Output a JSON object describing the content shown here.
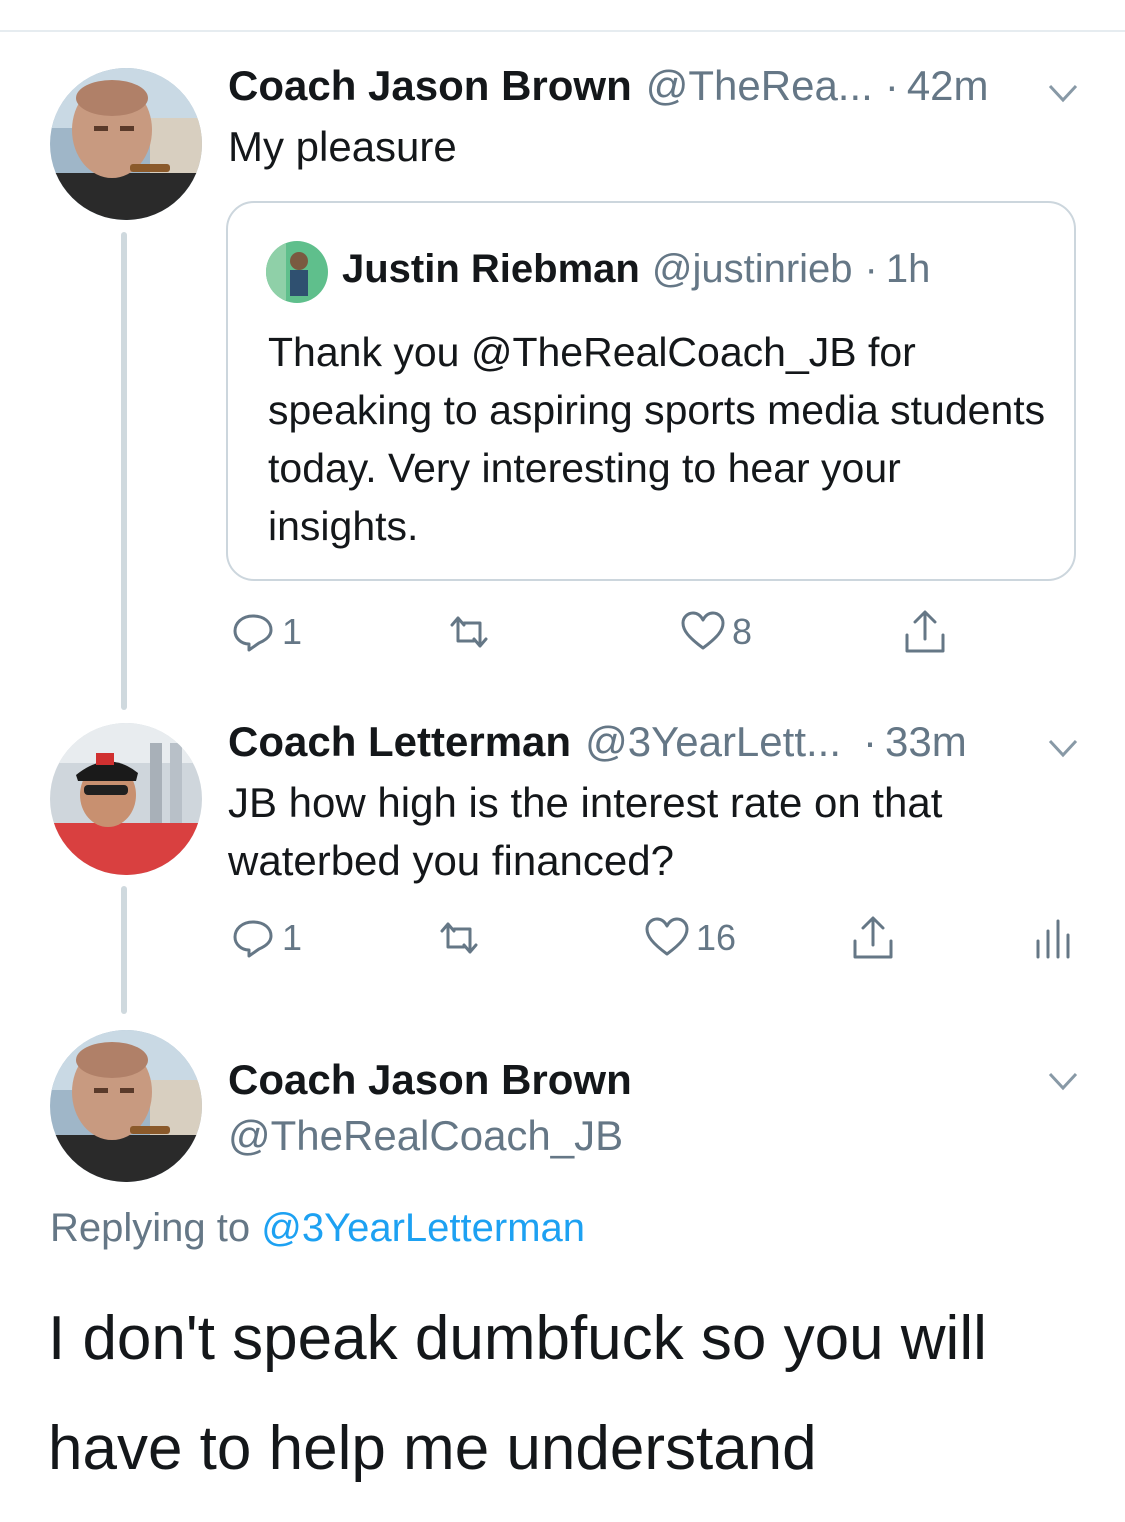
{
  "tweets": [
    {
      "name": "Coach Jason Brown",
      "handle": "@TheRea...",
      "dot": "·",
      "time": "42m",
      "text": "My pleasure",
      "quote": {
        "name": "Justin Riebman",
        "handle": "@justinrieb",
        "dot": "·",
        "time": "1h",
        "text": "Thank you @TheRealCoach_JB for speaking to aspiring sports media students today. Very interesting to hear your insights."
      },
      "actions": {
        "reply_count": "1",
        "retweet_count": "",
        "like_count": "8"
      }
    },
    {
      "name": "Coach Letterman",
      "handle": "@3YearLett...",
      "dot": "·",
      "time": "33m",
      "text": "JB how high is the interest rate on that waterbed you financed?",
      "actions": {
        "reply_count": "1",
        "retweet_count": "",
        "like_count": "16"
      }
    }
  ],
  "main_tweet": {
    "name": "Coach Jason Brown",
    "handle": "@TheRealCoach_JB",
    "replying_prefix": "Replying to",
    "replying_to": "@3YearLetterman",
    "text": "I don't speak dumbfuck so you will have to help me understand"
  },
  "icons": {
    "reply": "reply-icon",
    "retweet": "retweet-icon",
    "like": "heart-icon",
    "share": "share-icon",
    "analytics": "analytics-icon",
    "more": "chevron-down-icon"
  },
  "colors": {
    "text": "#14171a",
    "secondary": "#657786",
    "link": "#1da1f2",
    "border": "#ccd6dd",
    "thread_line": "#cfd9de"
  }
}
